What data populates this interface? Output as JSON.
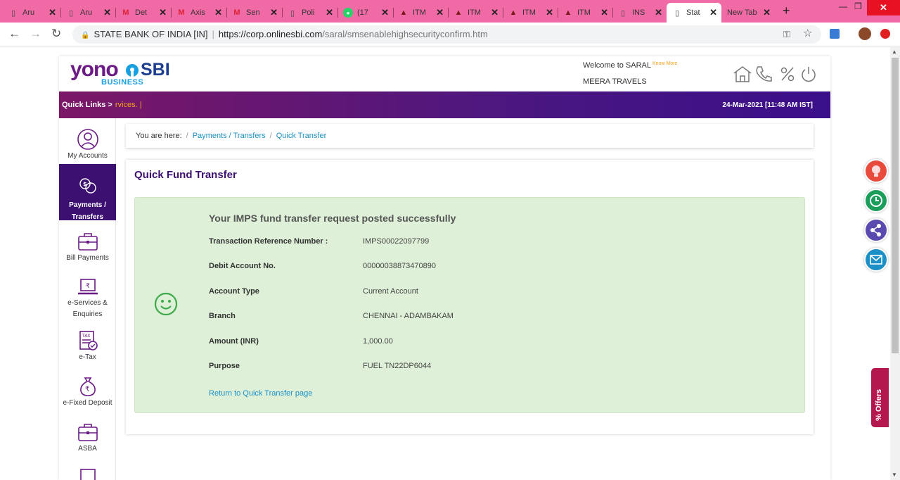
{
  "browser": {
    "tabs": [
      {
        "label": "Aru",
        "icon": "doc-icon"
      },
      {
        "label": "Aru",
        "icon": "doc-icon"
      },
      {
        "label": "Det",
        "icon": "gmail-icon"
      },
      {
        "label": "Axis",
        "icon": "gmail-icon"
      },
      {
        "label": "Sen",
        "icon": "gmail-icon"
      },
      {
        "label": "Poli",
        "icon": "doc-icon"
      },
      {
        "label": "(17",
        "icon": "whatsapp-icon"
      },
      {
        "label": "ITM",
        "icon": "itm-icon"
      },
      {
        "label": "ITM",
        "icon": "itm-icon"
      },
      {
        "label": "ITM",
        "icon": "itm-icon"
      },
      {
        "label": "ITM",
        "icon": "itm-icon"
      },
      {
        "label": "INS",
        "icon": "doc-icon"
      },
      {
        "label": "Stat",
        "icon": "doc-icon",
        "active": true
      },
      {
        "label": "New Tab",
        "icon": ""
      }
    ],
    "close_glyph": "✕",
    "new_tab_glyph": "+",
    "site_name": "STATE BANK OF INDIA [IN]",
    "url_prefix": "https://corp.onlinesbi.com",
    "url_path": "/saral/smsenablehighsecurityconfirm.htm"
  },
  "header": {
    "logo_yono": "yono",
    "logo_sbi": "SBI",
    "logo_business": "BUSINESS",
    "welcome": "Welcome to SARAL",
    "know_more": "Know More",
    "company": "MEERA TRAVELS",
    "icons": [
      "home-icon",
      "phone-icon",
      "offers-percent-icon",
      "power-icon"
    ]
  },
  "quickbar": {
    "label": "Quick Links",
    "arrow": ">",
    "ticker": "rvices. |",
    "datetime": "24-Mar-2021 [11:48 AM IST]"
  },
  "sidebar": {
    "items": [
      {
        "label": "My Accounts",
        "icon": "user-icon"
      },
      {
        "label": "Payments / Transfers",
        "icon": "payments-icon",
        "active": true
      },
      {
        "label": "Bill Payments",
        "icon": "briefcase-icon"
      },
      {
        "label": "e-Services & Enquiries",
        "icon": "laptop-icon"
      },
      {
        "label": "e-Tax",
        "icon": "tax-icon"
      },
      {
        "label": "e-Fixed Deposit",
        "icon": "money-bag-icon"
      },
      {
        "label": "ASBA",
        "icon": "briefcase-icon"
      }
    ]
  },
  "breadcrumb": {
    "prefix": "You are here:",
    "sep": "/",
    "items": [
      "Payments / Transfers",
      "Quick Transfer"
    ]
  },
  "card": {
    "title": "Quick Fund Transfer",
    "success_title": "Your IMPS fund transfer request posted successfully",
    "rows": [
      {
        "label": "Transaction Reference Number :",
        "value": "IMPS00022097799"
      },
      {
        "label": "Debit Account No.",
        "value": "00000038873470890"
      },
      {
        "label": "Account Type",
        "value": "Current Account"
      },
      {
        "label": "Branch",
        "value": "CHENNAI - ADAMBAKAM"
      },
      {
        "label": "Amount (INR)",
        "value": "1,000.00"
      },
      {
        "label": "Purpose",
        "value": "FUEL TN22DP6044"
      }
    ],
    "return_link": "Return to Quick Transfer page"
  },
  "floating": {
    "offers_label": "% Offers",
    "buttons": [
      "bulb-icon",
      "history-icon",
      "share-icon",
      "mail-icon"
    ],
    "colors": [
      "#e84a3c",
      "#1a9e5a",
      "#5a4ab0",
      "#1b8fc6"
    ]
  }
}
